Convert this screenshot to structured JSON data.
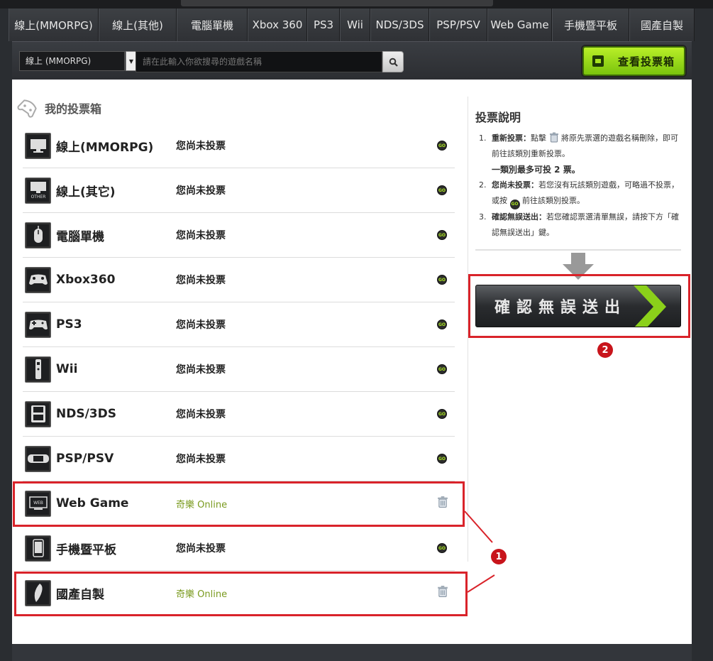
{
  "nav": {
    "tabs": [
      "線上(MMORPG)",
      "線上(其他)",
      "電腦單機",
      "Xbox 360",
      "PS3",
      "Wii",
      "NDS/3DS",
      "PSP/PSV",
      "Web Game",
      "手機暨平板",
      "國產自製"
    ]
  },
  "search": {
    "category_selected": "線上 (MMORPG)",
    "placeholder": "請在此輸入你欲搜尋的遊戲名稱",
    "view_box_label": "查看投票箱"
  },
  "vote_box": {
    "title": "我的投票箱",
    "rows": [
      {
        "category": "線上(MMORPG)",
        "status": "您尚未投票",
        "icon": "monitor-icon",
        "action": "go"
      },
      {
        "category": "線上(其它)",
        "status": "您尚未投票",
        "icon": "monitor-other-icon",
        "action": "go"
      },
      {
        "category": "電腦單機",
        "status": "您尚未投票",
        "icon": "mouse-icon",
        "action": "go"
      },
      {
        "category": "Xbox360",
        "status": "您尚未投票",
        "icon": "gamepad-icon",
        "action": "go"
      },
      {
        "category": "PS3",
        "status": "您尚未投票",
        "icon": "ps-controller-icon",
        "action": "go"
      },
      {
        "category": "Wii",
        "status": "您尚未投票",
        "icon": "wii-remote-icon",
        "action": "go"
      },
      {
        "category": "NDS/3DS",
        "status": "您尚未投票",
        "icon": "nds-icon",
        "action": "go"
      },
      {
        "category": "PSP/PSV",
        "status": "您尚未投票",
        "icon": "psp-icon",
        "action": "go"
      },
      {
        "category": "Web Game",
        "status": "奇樂 Online",
        "icon": "web-icon",
        "action": "trash"
      },
      {
        "category": "手機暨平板",
        "status": "您尚未投票",
        "icon": "phone-icon",
        "action": "go"
      },
      {
        "category": "國產自製",
        "status": "奇樂 Online",
        "icon": "taiwan-icon",
        "action": "trash"
      }
    ]
  },
  "instructions": {
    "title": "投票說明",
    "items": [
      {
        "num": "1.",
        "bold": "重新投票：",
        "pre": "點擊",
        "post": "將原先票選的遊戲名稱刪除，即可前往該類別重新投票。"
      },
      {
        "num": "2.",
        "bold": "您尚未投票：",
        "pre": "若您沒有玩該類別遊戲，可略過不投票，或按",
        "post": "前往該類別投票。"
      },
      {
        "num": "3.",
        "bold": "確認無誤送出：",
        "pre": "若您確認票選清單無誤，請按下方「確認無誤送出」鍵。",
        "post": ""
      }
    ],
    "limit_note": "一類別最多可投 2 票。",
    "confirm_label": "確認無誤送出"
  },
  "annotations": {
    "badge_1": "1",
    "badge_2": "2"
  },
  "colors": {
    "accent_green": "#a8e31f",
    "highlight_red": "#d9232a",
    "vote_text": "#7a9a1e"
  }
}
